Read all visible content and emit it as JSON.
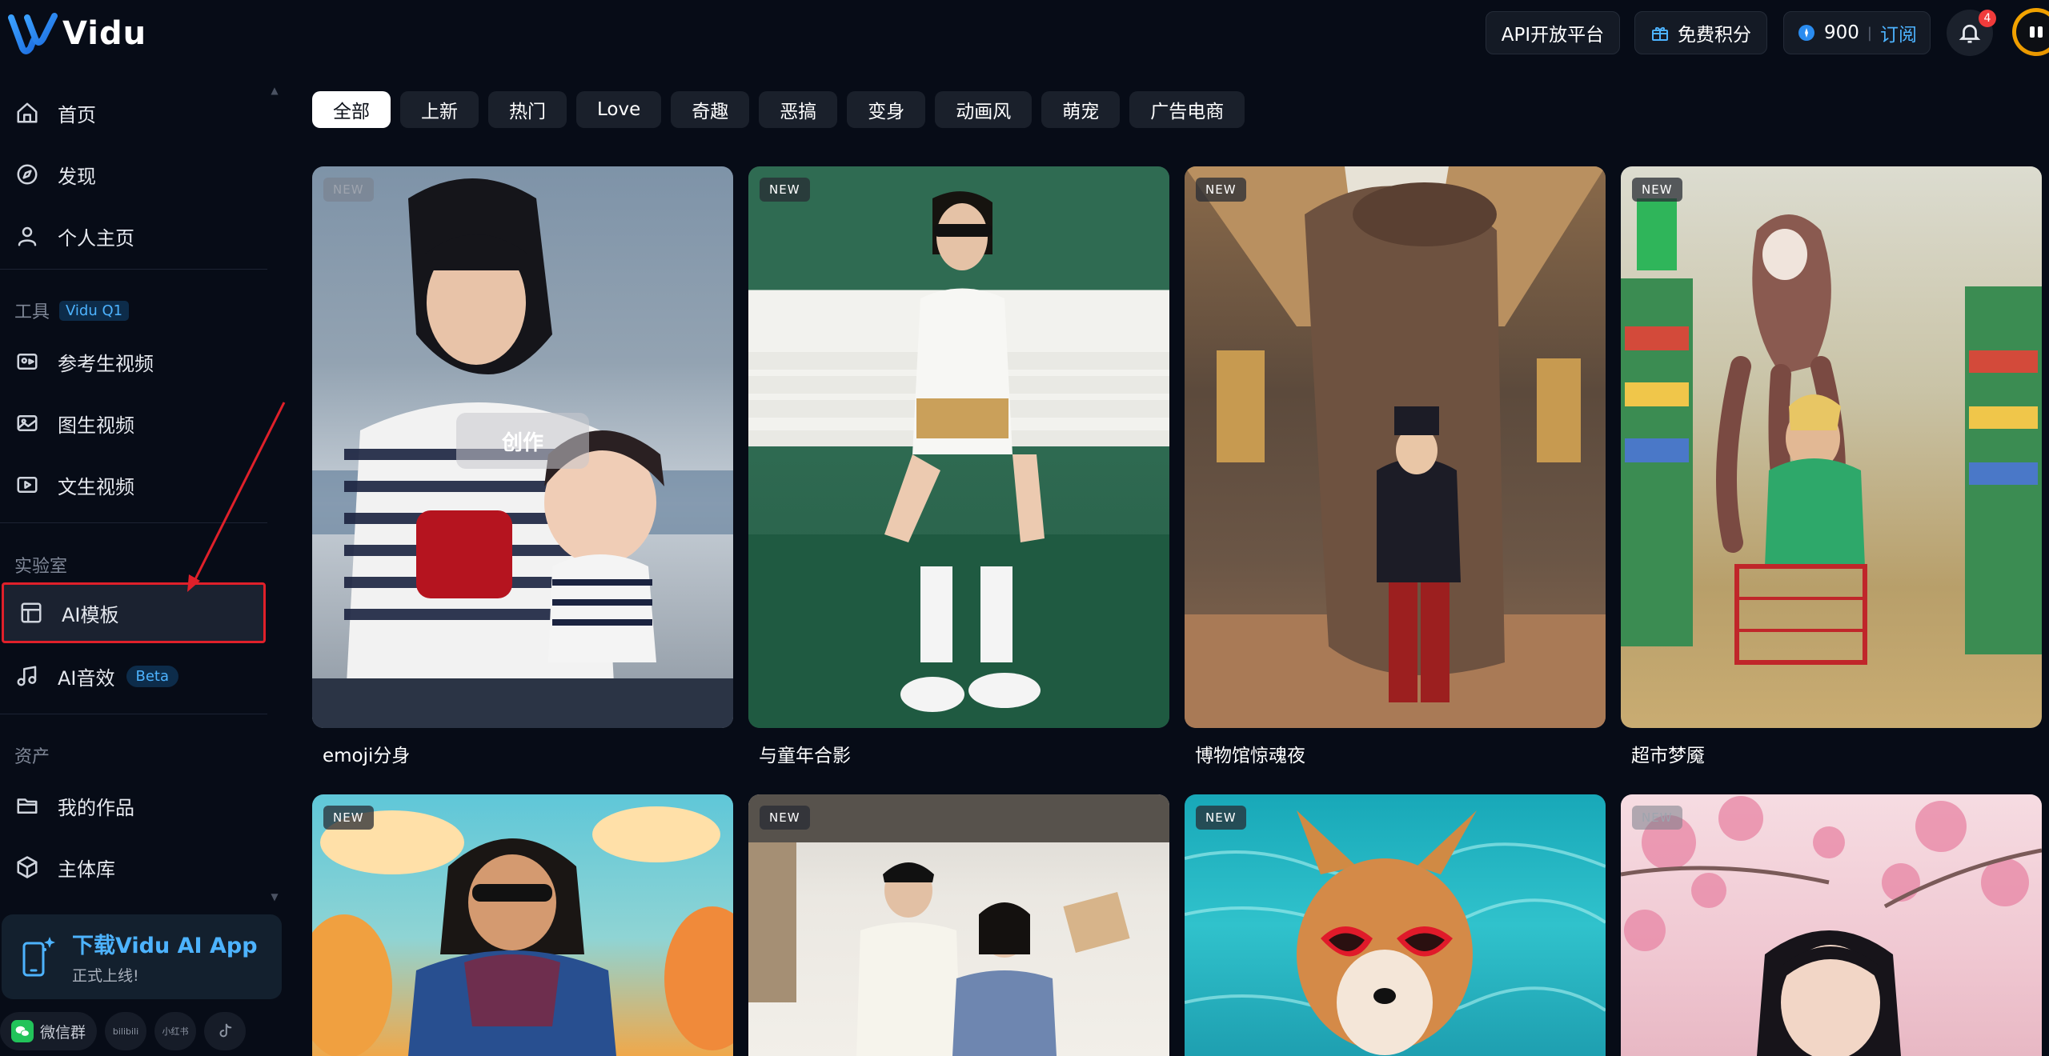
{
  "brand": {
    "name": "Vidu"
  },
  "sidebar": {
    "main_items": [
      {
        "label": "首页",
        "icon": "home-icon"
      },
      {
        "label": "发现",
        "icon": "compass-icon"
      },
      {
        "label": "个人主页",
        "icon": "user-icon"
      }
    ],
    "tools_section": {
      "label": "工具",
      "badge": "Vidu Q1"
    },
    "tool_items": [
      {
        "label": "参考生视频",
        "icon": "reference-video-icon"
      },
      {
        "label": "图生视频",
        "icon": "image-video-icon"
      },
      {
        "label": "文生视频",
        "icon": "text-video-icon"
      }
    ],
    "lab_section": {
      "label": "实验室"
    },
    "lab_items": [
      {
        "label": "AI模板",
        "icon": "template-icon",
        "active": true
      },
      {
        "label": "AI音效",
        "icon": "music-icon",
        "badge": "Beta"
      }
    ],
    "assets_section": {
      "label": "资产"
    },
    "asset_items": [
      {
        "label": "我的作品",
        "icon": "folder-icon"
      },
      {
        "label": "主体库",
        "icon": "cube-icon"
      }
    ],
    "app_promo": {
      "title": "下载Vidu AI App",
      "subtitle": "正式上线!"
    },
    "social": [
      {
        "label": "微信群",
        "icon": "wechat-icon"
      },
      {
        "label": "bilibili",
        "icon": "bilibili-icon"
      },
      {
        "label": "小红书",
        "icon": "xiaohongshu-icon"
      },
      {
        "label": "",
        "icon": "tiktok-icon"
      }
    ]
  },
  "topbar": {
    "api_label": "API开放平台",
    "free_credits_label": "免费积分",
    "credits": "900",
    "subscribe_label": "订阅",
    "notification_count": "4"
  },
  "tabs": [
    "全部",
    "上新",
    "热门",
    "Love",
    "奇趣",
    "恶搞",
    "变身",
    "动画风",
    "萌宠",
    "广告电商"
  ],
  "active_tab": "全部",
  "cards": [
    {
      "title": "emoji分身",
      "badge": "NEW",
      "hover_button": "创作"
    },
    {
      "title": "与童年合影",
      "badge": "NEW"
    },
    {
      "title": "博物馆惊魂夜",
      "badge": "NEW"
    },
    {
      "title": "超市梦魇",
      "badge": "NEW"
    },
    {
      "title": "",
      "badge": "NEW"
    },
    {
      "title": "",
      "badge": "NEW"
    },
    {
      "title": "",
      "badge": "NEW"
    },
    {
      "title": "",
      "badge": "NEW"
    }
  ],
  "colors": {
    "accent": "#4db3ff",
    "highlight_border": "#e0202a",
    "background": "#070c17"
  }
}
